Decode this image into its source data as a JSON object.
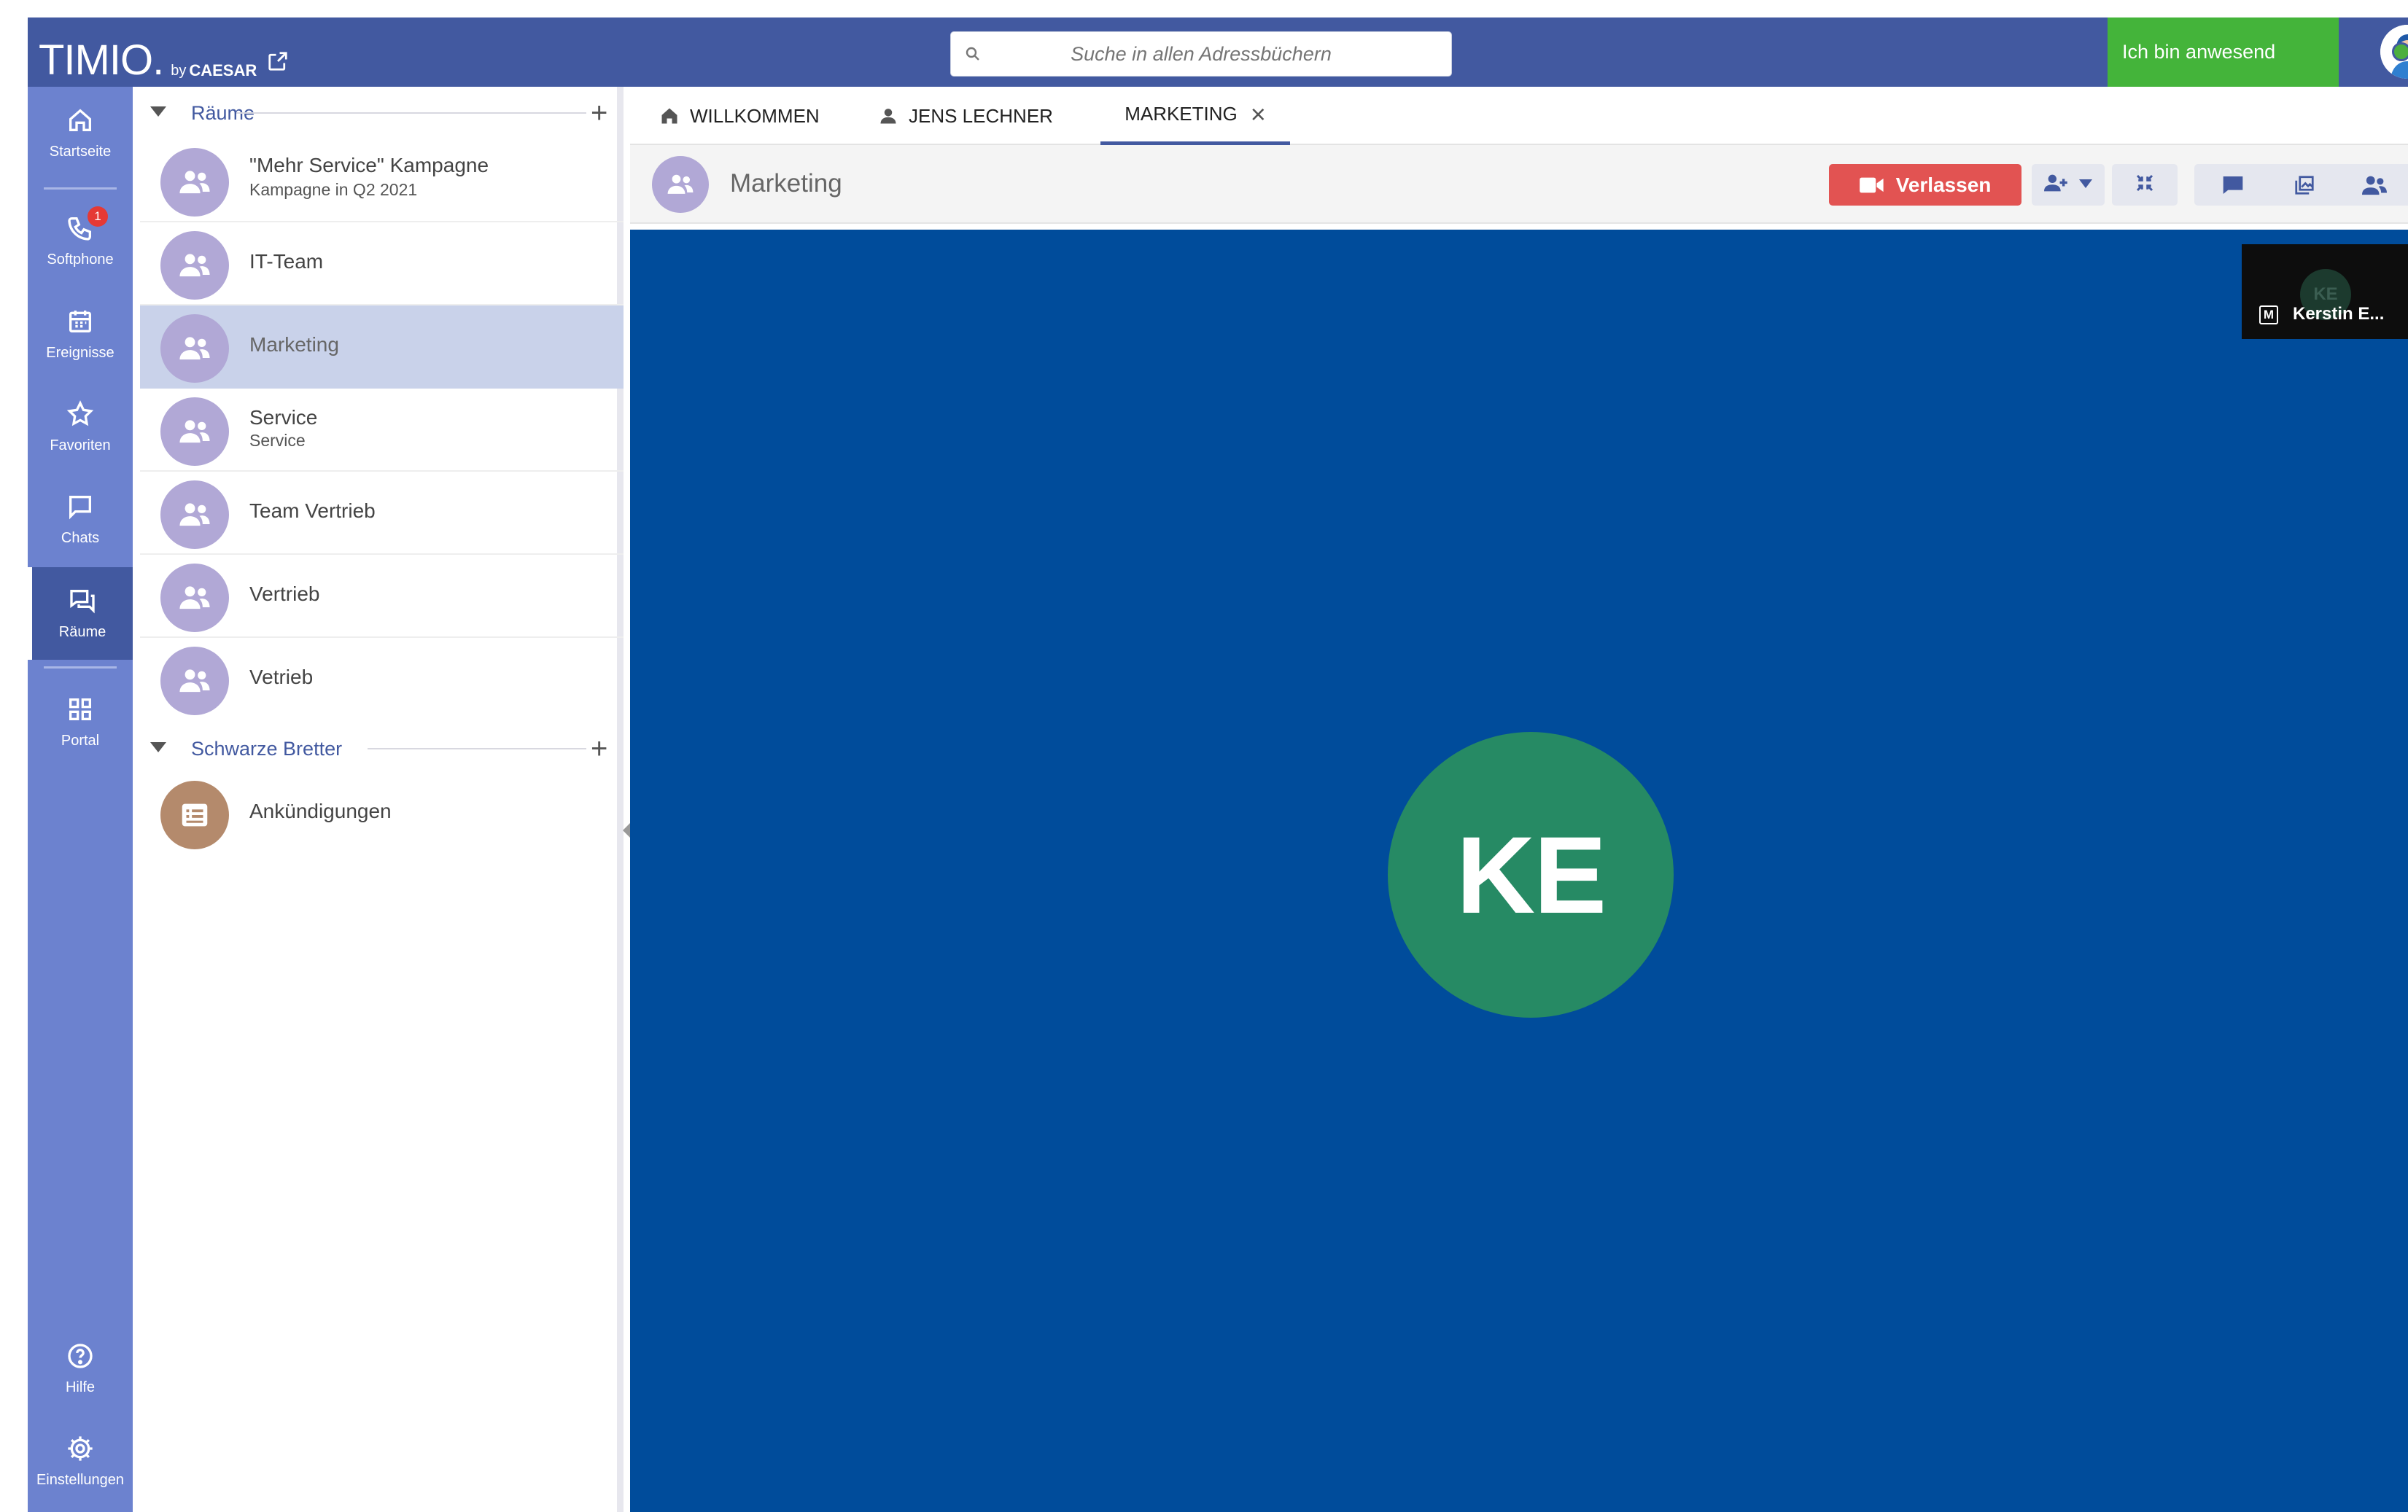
{
  "app": {
    "brand": "TIMIO.",
    "by": "by",
    "vendor": "CAESAR"
  },
  "search": {
    "placeholder": "Suche in allen Adressbüchern"
  },
  "presence": {
    "label": "Ich bin anwesend",
    "color": "#44b43a"
  },
  "nav": {
    "items": [
      {
        "label": "Startseite",
        "icon": "home-icon"
      },
      {
        "label": "Softphone",
        "icon": "phone-icon",
        "badge": "1"
      },
      {
        "label": "Ereignisse",
        "icon": "calendar-icon"
      },
      {
        "label": "Favoriten",
        "icon": "star-icon"
      },
      {
        "label": "Chats",
        "icon": "chat-icon"
      },
      {
        "label": "Räume",
        "icon": "rooms-icon",
        "active": true
      },
      {
        "label": "Portal",
        "icon": "grid-icon"
      },
      {
        "label": "Hilfe",
        "icon": "help-icon"
      },
      {
        "label": "Einstellungen",
        "icon": "gear-icon"
      }
    ]
  },
  "rooms": {
    "section_title": "Räume",
    "items": [
      {
        "name": "\"Mehr Service\" Kampagne",
        "sub": "Kampagne in Q2 2021"
      },
      {
        "name": "IT-Team",
        "sub": ""
      },
      {
        "name": "Marketing",
        "sub": "",
        "selected": true
      },
      {
        "name": "Service",
        "sub": "Service"
      },
      {
        "name": "Team Vertrieb",
        "sub": ""
      },
      {
        "name": "Vertrieb",
        "sub": ""
      },
      {
        "name": "Vetrieb",
        "sub": ""
      }
    ]
  },
  "boards": {
    "section_title": "Schwarze Bretter",
    "items": [
      {
        "name": "Ankündigungen"
      }
    ]
  },
  "tabs": [
    {
      "label": "WILLKOMMEN",
      "icon": "home-icon"
    },
    {
      "label": "JENS LECHNER",
      "icon": "person-icon"
    },
    {
      "label": "MARKETING",
      "active": true
    }
  ],
  "room_header": {
    "name": "Marketing",
    "leave_label": "Verlassen",
    "leave_color": "#e25352"
  },
  "stage": {
    "participant_initials": "KE",
    "thumb_initials": "KE",
    "thumb_badge": "M",
    "thumb_name": "Kerstin E...",
    "background": "#004c9b",
    "avatar_color": "#268a64"
  }
}
